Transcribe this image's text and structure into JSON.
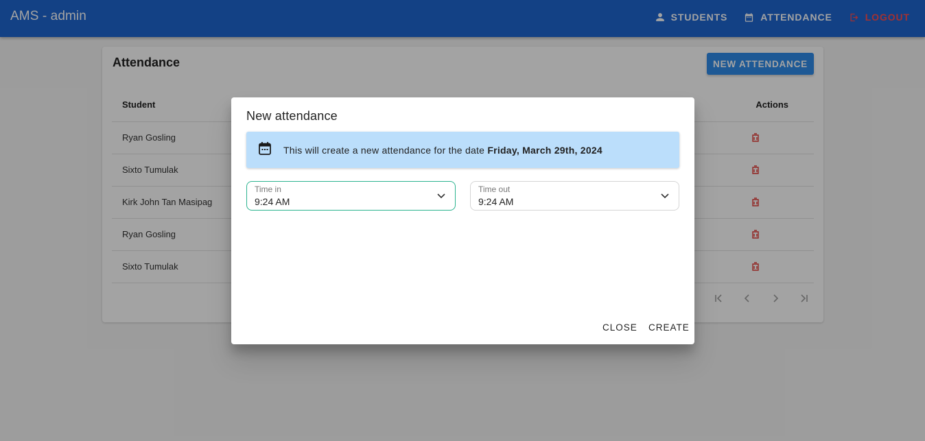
{
  "app": {
    "title": "AMS - admin"
  },
  "nav": [
    {
      "label": "STUDENTS",
      "icon": "person-icon"
    },
    {
      "label": "ATTENDANCE",
      "icon": "calendar-icon"
    },
    {
      "label": "LOGOUT",
      "icon": "logout-icon"
    }
  ],
  "page": {
    "title": "Attendance",
    "new_button": "NEW ATTENDANCE",
    "columns": {
      "student": "Student",
      "actions": "Actions"
    },
    "rows": [
      {
        "student": "Ryan Gosling"
      },
      {
        "student": "Sixto Tumulak"
      },
      {
        "student": "Kirk John Tan Masipag"
      },
      {
        "student": "Ryan Gosling"
      },
      {
        "student": "Sixto Tumulak"
      }
    ]
  },
  "dialog": {
    "title": "New attendance",
    "alert_prefix": "This will create a new attendance for the date",
    "alert_date": "Friday, March 29th, 2024",
    "time_in": {
      "label": "Time in",
      "value": "9:24 AM"
    },
    "time_out": {
      "label": "Time out",
      "value": "9:24 AM"
    },
    "close_label": "CLOSE",
    "create_label": "CREATE"
  },
  "colors": {
    "appbar": "#1f66d1",
    "primary_button": "#2f8cea",
    "alert_bg": "#bbdefb",
    "danger": "#ff4d4d",
    "focus": "#2bb38f"
  }
}
